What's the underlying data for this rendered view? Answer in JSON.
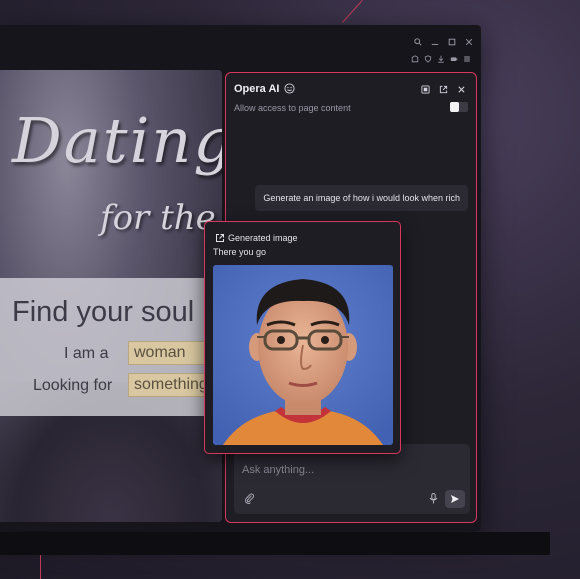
{
  "colors": {
    "accent": "#d8365f",
    "panel_bg": "#1e1d24",
    "bubble_bg": "#2b2a33",
    "form_input_bg": "#d8c7a0"
  },
  "window_controls": [
    "search-icon",
    "minimize-icon",
    "maximize-icon",
    "close-icon"
  ],
  "toolbar_icons": [
    "tab-icon",
    "shield-icon",
    "download-icon",
    "battery-icon",
    "menu-icon"
  ],
  "webpage": {
    "hero_title": "Dating",
    "hero_subtitle": "for the",
    "find_heading": "Find your soul",
    "gender_label": "I am a",
    "gender_value": "woman",
    "seeking_label": "Looking for",
    "seeking_value": "something"
  },
  "ai_panel": {
    "title": "Opera AI",
    "title_icon": "smile-icon",
    "header_icons": [
      "copy-icon",
      "external-link-icon",
      "close-icon"
    ],
    "access_label": "Allow access to page content",
    "access_enabled": false,
    "user_message": "Generate an image of how i would look when rich",
    "input_placeholder": "Ask anything...",
    "input_icons": [
      "paperclip-icon",
      "microphone-icon",
      "send-icon"
    ]
  },
  "generated_card": {
    "icon": "image-export-icon",
    "label": "Generated image",
    "reply": "There you go",
    "image": "portrait-photo"
  }
}
